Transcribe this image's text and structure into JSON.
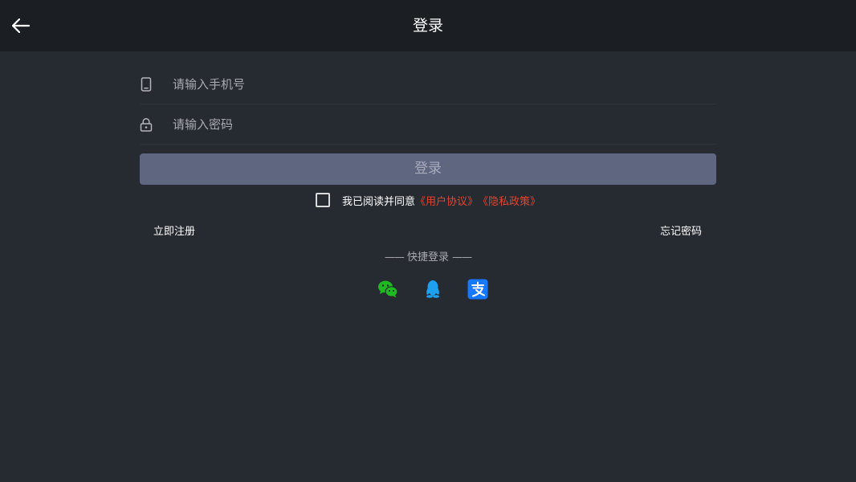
{
  "header": {
    "title": "登录",
    "back_icon": "arrow-left-icon"
  },
  "form": {
    "phone": {
      "placeholder": "请输入手机号",
      "value": "",
      "icon": "phone-icon"
    },
    "password": {
      "placeholder": "请输入密码",
      "value": "",
      "icon": "lock-icon"
    },
    "login_label": "登录"
  },
  "agreement": {
    "checked": false,
    "text": "我已阅读并同意",
    "user_agreement": "《用户协议》",
    "privacy_policy": "《隐私政策》"
  },
  "links": {
    "register": "立即注册",
    "forgot_password": "忘记密码"
  },
  "quick_login": {
    "left_dash": "——",
    "label": "快捷登录",
    "right_dash": "——",
    "providers": [
      {
        "name": "wechat",
        "icon": "wechat-icon",
        "color": "#1fb922"
      },
      {
        "name": "qq",
        "icon": "qq-icon",
        "color": "#1ea0f1"
      },
      {
        "name": "alipay",
        "icon": "alipay-icon",
        "color": "#1677ff"
      }
    ]
  },
  "colors": {
    "background": "#262a31",
    "header": "#1b1e22",
    "button": "#5f6680",
    "link": "#e2452f"
  }
}
